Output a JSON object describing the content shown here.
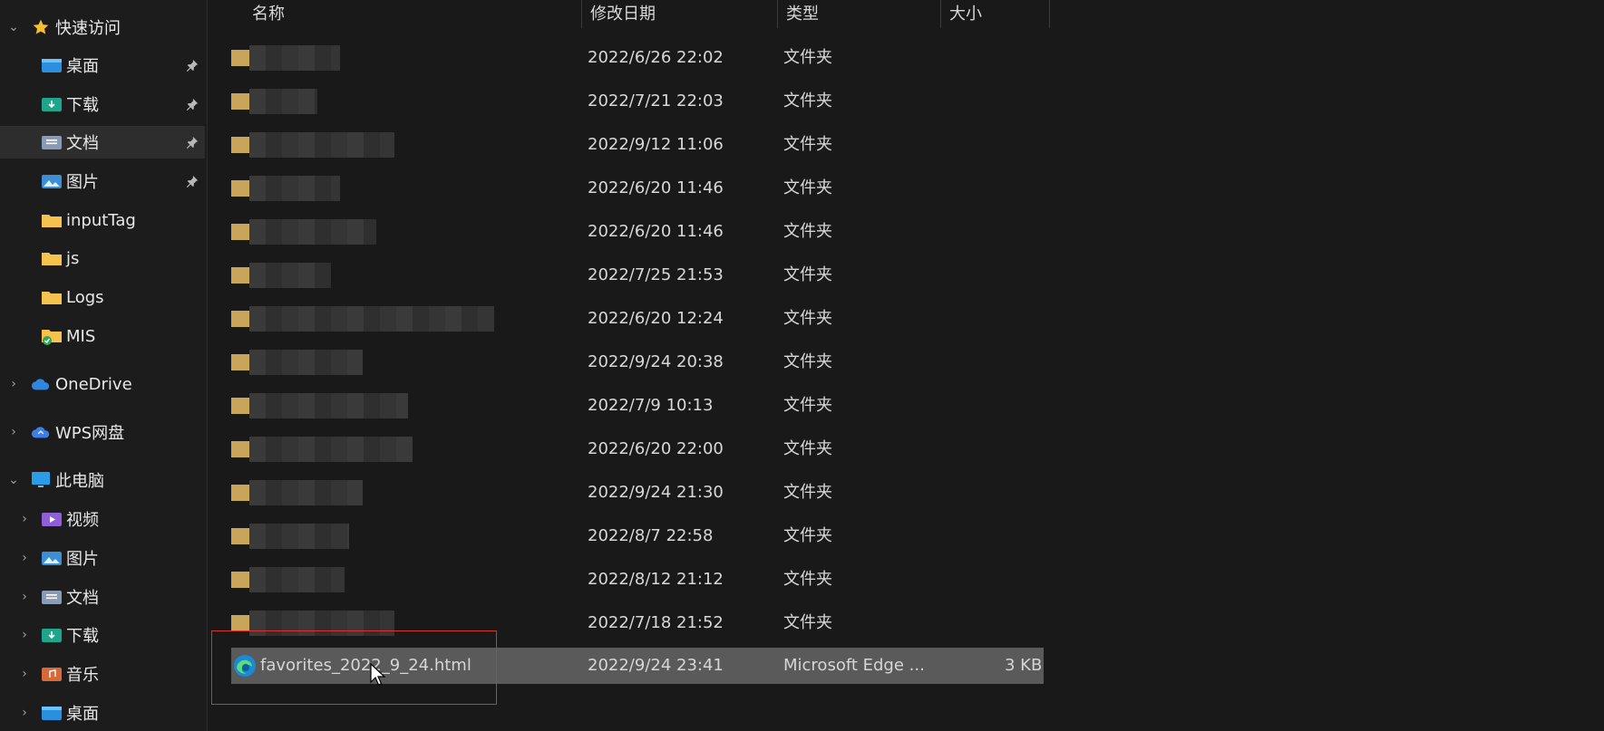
{
  "sidebar": {
    "quick_access": {
      "label": "快速访问",
      "expanded": true
    },
    "quick_items": [
      {
        "label": "桌面",
        "icon": "desktop-folder-icon",
        "pinned": true
      },
      {
        "label": "下载",
        "icon": "downloads-folder-icon",
        "pinned": true
      },
      {
        "label": "文档",
        "icon": "documents-folder-icon",
        "pinned": true,
        "selected": true
      },
      {
        "label": "图片",
        "icon": "pictures-folder-icon",
        "pinned": true
      },
      {
        "label": "inputTag",
        "icon": "folder-icon"
      },
      {
        "label": "js",
        "icon": "folder-icon"
      },
      {
        "label": "Logs",
        "icon": "folder-icon"
      },
      {
        "label": "MIS",
        "icon": "shared-folder-icon"
      }
    ],
    "onedrive": {
      "label": "OneDrive",
      "icon": "cloud-icon"
    },
    "wps": {
      "label": "WPS网盘",
      "icon": "wps-cloud-icon"
    },
    "this_pc": {
      "label": "此电脑",
      "icon": "monitor-icon",
      "expanded": true
    },
    "pc_items": [
      {
        "label": "视频",
        "icon": "videos-folder-icon"
      },
      {
        "label": "图片",
        "icon": "pictures-folder-icon"
      },
      {
        "label": "文档",
        "icon": "documents-folder-icon"
      },
      {
        "label": "下载",
        "icon": "downloads-folder-icon"
      },
      {
        "label": "音乐",
        "icon": "music-folder-icon"
      },
      {
        "label": "桌面",
        "icon": "desktop-folder-icon"
      }
    ]
  },
  "columns": {
    "name": "名称",
    "date": "修改日期",
    "type": "类型",
    "size": "大小"
  },
  "files": [
    {
      "date": "2022/6/26 22:02",
      "type": "文件夹"
    },
    {
      "date": "2022/7/21 22:03",
      "type": "文件夹"
    },
    {
      "date": "2022/9/12 11:06",
      "type": "文件夹"
    },
    {
      "date": "2022/6/20 11:46",
      "type": "文件夹"
    },
    {
      "date": "2022/6/20 11:46",
      "type": "文件夹"
    },
    {
      "date": "2022/7/25 21:53",
      "type": "文件夹"
    },
    {
      "date": "2022/6/20 12:24",
      "type": "文件夹"
    },
    {
      "date": "2022/9/24 20:38",
      "type": "文件夹"
    },
    {
      "date": "2022/7/9 10:13",
      "type": "文件夹"
    },
    {
      "date": "2022/6/20 22:00",
      "type": "文件夹"
    },
    {
      "date": "2022/9/24 21:30",
      "type": "文件夹"
    },
    {
      "date": "2022/8/7 22:58",
      "type": "文件夹"
    },
    {
      "date": "2022/8/12 21:12",
      "type": "文件夹"
    },
    {
      "date": "2022/7/18 21:52",
      "type": "文件夹"
    }
  ],
  "selected_file": {
    "name": "favorites_2022_9_24.html",
    "date": "2022/9/24 23:41",
    "type": "Microsoft Edge ...",
    "size": "3 KB",
    "icon": "edge-icon"
  },
  "colors": {
    "folder": "#c9a55a",
    "highlight_box": "#d9342b",
    "selection": "#5a5a5a"
  }
}
